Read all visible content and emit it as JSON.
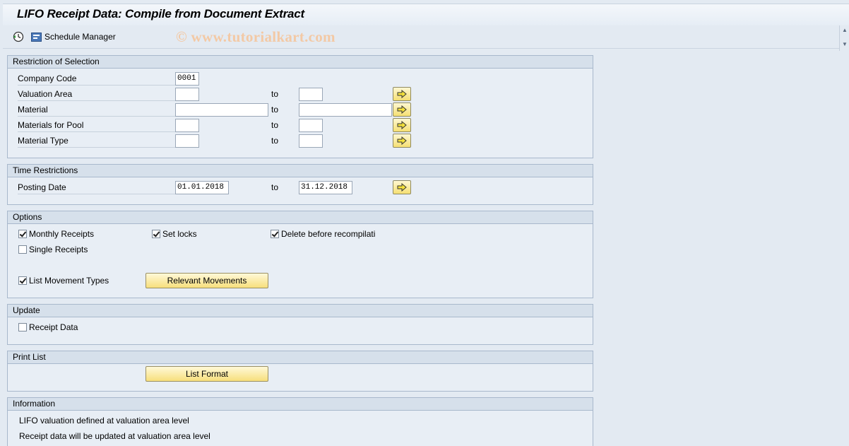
{
  "window": {
    "title": "LIFO Receipt Data: Compile from Document Extract"
  },
  "toolbar": {
    "execute_icon": "clock-execute-icon",
    "schedule_icon": "schedule-manager-icon",
    "schedule_label": "Schedule Manager",
    "watermark": "© www.tutorialkart.com"
  },
  "restriction": {
    "header": "Restriction of Selection",
    "to_label": "to",
    "rows": [
      {
        "label": "Company Code",
        "from": "0001",
        "to": null
      },
      {
        "label": "Valuation Area",
        "from": "",
        "to": ""
      },
      {
        "label": "Material",
        "from": "",
        "to": ""
      },
      {
        "label": "Materials for Pool",
        "from": "",
        "to": ""
      },
      {
        "label": "Material Type",
        "from": "",
        "to": ""
      }
    ]
  },
  "time": {
    "header": "Time Restrictions",
    "posting_label": "Posting Date",
    "to_label": "to",
    "from": "01.01.2018",
    "to": "31.12.2018"
  },
  "options": {
    "header": "Options",
    "monthly_receipts": {
      "label": "Monthly Receipts",
      "checked": true
    },
    "set_locks": {
      "label": "Set locks",
      "checked": true
    },
    "delete_before": {
      "label": "Delete before recompilati",
      "checked": true
    },
    "single_receipts": {
      "label": "Single Receipts",
      "checked": false
    },
    "list_movement_types": {
      "label": "List Movement Types",
      "checked": true
    },
    "relevant_movements_button": "Relevant Movements"
  },
  "update": {
    "header": "Update",
    "receipt_data": {
      "label": "Receipt Data",
      "checked": false
    }
  },
  "print_list": {
    "header": "Print List",
    "list_format_button": "List Format"
  },
  "information": {
    "header": "Information",
    "lines": [
      "LIFO valuation defined at valuation area level",
      "Receipt data will be updated at valuation area level"
    ]
  },
  "colors": {
    "button_yellow": "#f7df7c",
    "group_header": "#d6e0eb",
    "background": "#e3eaf2"
  }
}
